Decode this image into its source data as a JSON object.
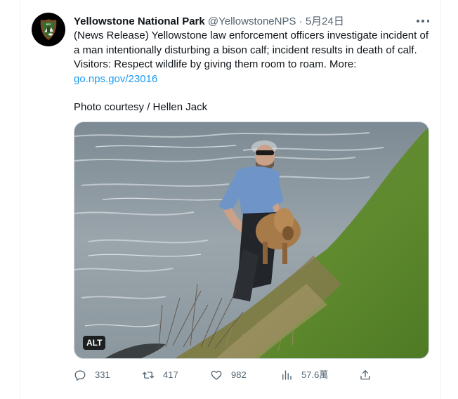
{
  "tweet": {
    "display_name": "Yellowstone National Park",
    "handle": "@YellowstoneNPS",
    "separator": "·",
    "date": "5月24日",
    "text_body": "(News Release) Yellowstone law enforcement officers investigate incident of a man intentionally disturbing a bison calf; incident results in death of calf. Visitors: Respect wildlife by giving them room to roam. More:",
    "link": "go.nps.gov/23016",
    "credit": "Photo courtesy / Hellen Jack",
    "alt_badge": "ALT",
    "avatar_icon": "nps-arrowhead-logo-icon",
    "more_icon": "more-dots-icon"
  },
  "actions": {
    "replies": {
      "icon": "reply-icon",
      "count": "331"
    },
    "retweets": {
      "icon": "retweet-icon",
      "count": "417"
    },
    "likes": {
      "icon": "like-heart-icon",
      "count": "982"
    },
    "views": {
      "icon": "views-chart-icon",
      "count": "57.6萬"
    },
    "share": {
      "icon": "share-icon"
    }
  },
  "colors": {
    "text": "#0f1419",
    "secondary": "#536471",
    "link": "#1d9bf0",
    "border": "#eff3f4"
  }
}
